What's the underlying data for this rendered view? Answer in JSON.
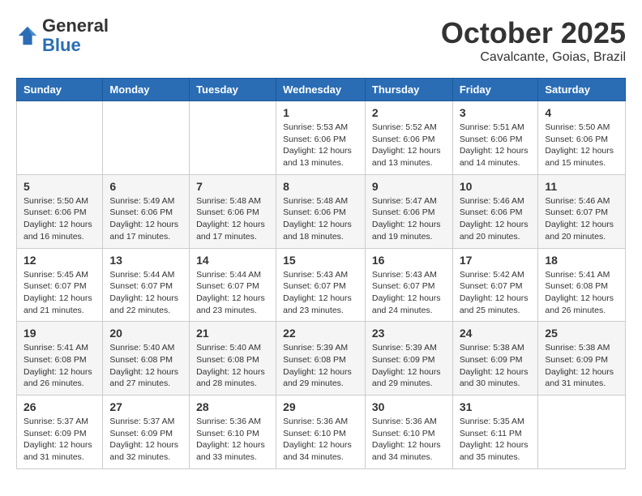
{
  "logo": {
    "general": "General",
    "blue": "Blue"
  },
  "header": {
    "month": "October 2025",
    "location": "Cavalcante, Goias, Brazil"
  },
  "weekdays": [
    "Sunday",
    "Monday",
    "Tuesday",
    "Wednesday",
    "Thursday",
    "Friday",
    "Saturday"
  ],
  "weeks": [
    [
      {
        "day": "",
        "info": ""
      },
      {
        "day": "",
        "info": ""
      },
      {
        "day": "",
        "info": ""
      },
      {
        "day": "1",
        "info": "Sunrise: 5:53 AM\nSunset: 6:06 PM\nDaylight: 12 hours\nand 13 minutes."
      },
      {
        "day": "2",
        "info": "Sunrise: 5:52 AM\nSunset: 6:06 PM\nDaylight: 12 hours\nand 13 minutes."
      },
      {
        "day": "3",
        "info": "Sunrise: 5:51 AM\nSunset: 6:06 PM\nDaylight: 12 hours\nand 14 minutes."
      },
      {
        "day": "4",
        "info": "Sunrise: 5:50 AM\nSunset: 6:06 PM\nDaylight: 12 hours\nand 15 minutes."
      }
    ],
    [
      {
        "day": "5",
        "info": "Sunrise: 5:50 AM\nSunset: 6:06 PM\nDaylight: 12 hours\nand 16 minutes."
      },
      {
        "day": "6",
        "info": "Sunrise: 5:49 AM\nSunset: 6:06 PM\nDaylight: 12 hours\nand 17 minutes."
      },
      {
        "day": "7",
        "info": "Sunrise: 5:48 AM\nSunset: 6:06 PM\nDaylight: 12 hours\nand 17 minutes."
      },
      {
        "day": "8",
        "info": "Sunrise: 5:48 AM\nSunset: 6:06 PM\nDaylight: 12 hours\nand 18 minutes."
      },
      {
        "day": "9",
        "info": "Sunrise: 5:47 AM\nSunset: 6:06 PM\nDaylight: 12 hours\nand 19 minutes."
      },
      {
        "day": "10",
        "info": "Sunrise: 5:46 AM\nSunset: 6:06 PM\nDaylight: 12 hours\nand 20 minutes."
      },
      {
        "day": "11",
        "info": "Sunrise: 5:46 AM\nSunset: 6:07 PM\nDaylight: 12 hours\nand 20 minutes."
      }
    ],
    [
      {
        "day": "12",
        "info": "Sunrise: 5:45 AM\nSunset: 6:07 PM\nDaylight: 12 hours\nand 21 minutes."
      },
      {
        "day": "13",
        "info": "Sunrise: 5:44 AM\nSunset: 6:07 PM\nDaylight: 12 hours\nand 22 minutes."
      },
      {
        "day": "14",
        "info": "Sunrise: 5:44 AM\nSunset: 6:07 PM\nDaylight: 12 hours\nand 23 minutes."
      },
      {
        "day": "15",
        "info": "Sunrise: 5:43 AM\nSunset: 6:07 PM\nDaylight: 12 hours\nand 23 minutes."
      },
      {
        "day": "16",
        "info": "Sunrise: 5:43 AM\nSunset: 6:07 PM\nDaylight: 12 hours\nand 24 minutes."
      },
      {
        "day": "17",
        "info": "Sunrise: 5:42 AM\nSunset: 6:07 PM\nDaylight: 12 hours\nand 25 minutes."
      },
      {
        "day": "18",
        "info": "Sunrise: 5:41 AM\nSunset: 6:08 PM\nDaylight: 12 hours\nand 26 minutes."
      }
    ],
    [
      {
        "day": "19",
        "info": "Sunrise: 5:41 AM\nSunset: 6:08 PM\nDaylight: 12 hours\nand 26 minutes."
      },
      {
        "day": "20",
        "info": "Sunrise: 5:40 AM\nSunset: 6:08 PM\nDaylight: 12 hours\nand 27 minutes."
      },
      {
        "day": "21",
        "info": "Sunrise: 5:40 AM\nSunset: 6:08 PM\nDaylight: 12 hours\nand 28 minutes."
      },
      {
        "day": "22",
        "info": "Sunrise: 5:39 AM\nSunset: 6:08 PM\nDaylight: 12 hours\nand 29 minutes."
      },
      {
        "day": "23",
        "info": "Sunrise: 5:39 AM\nSunset: 6:09 PM\nDaylight: 12 hours\nand 29 minutes."
      },
      {
        "day": "24",
        "info": "Sunrise: 5:38 AM\nSunset: 6:09 PM\nDaylight: 12 hours\nand 30 minutes."
      },
      {
        "day": "25",
        "info": "Sunrise: 5:38 AM\nSunset: 6:09 PM\nDaylight: 12 hours\nand 31 minutes."
      }
    ],
    [
      {
        "day": "26",
        "info": "Sunrise: 5:37 AM\nSunset: 6:09 PM\nDaylight: 12 hours\nand 31 minutes."
      },
      {
        "day": "27",
        "info": "Sunrise: 5:37 AM\nSunset: 6:09 PM\nDaylight: 12 hours\nand 32 minutes."
      },
      {
        "day": "28",
        "info": "Sunrise: 5:36 AM\nSunset: 6:10 PM\nDaylight: 12 hours\nand 33 minutes."
      },
      {
        "day": "29",
        "info": "Sunrise: 5:36 AM\nSunset: 6:10 PM\nDaylight: 12 hours\nand 34 minutes."
      },
      {
        "day": "30",
        "info": "Sunrise: 5:36 AM\nSunset: 6:10 PM\nDaylight: 12 hours\nand 34 minutes."
      },
      {
        "day": "31",
        "info": "Sunrise: 5:35 AM\nSunset: 6:11 PM\nDaylight: 12 hours\nand 35 minutes."
      },
      {
        "day": "",
        "info": ""
      }
    ]
  ]
}
